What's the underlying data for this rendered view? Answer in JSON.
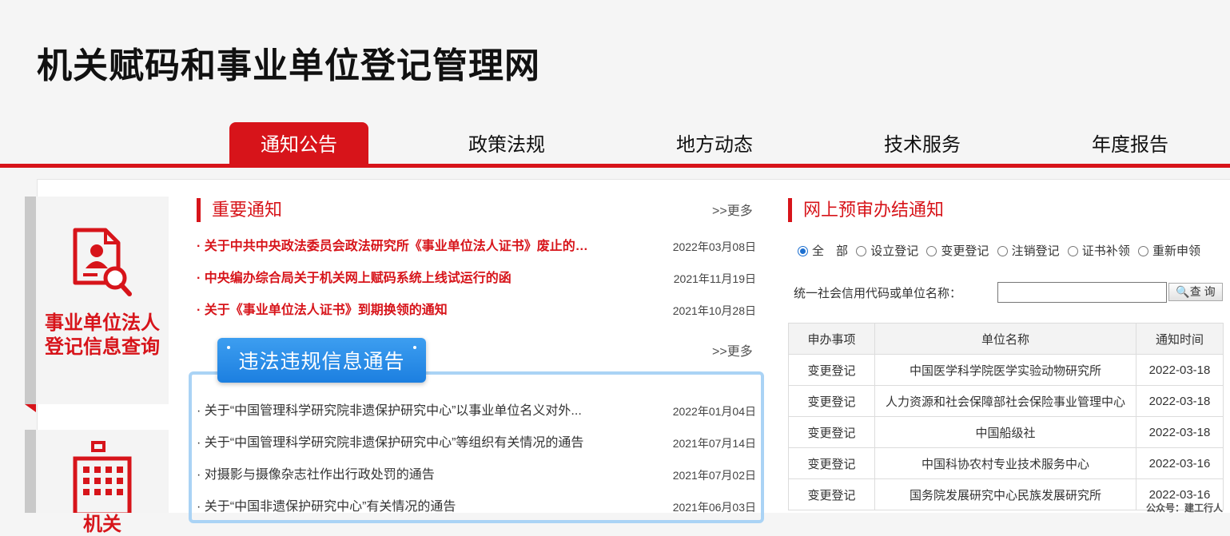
{
  "site": {
    "title": "机关赋码和事业单位登记管理网"
  },
  "nav": [
    {
      "label": "通知公告",
      "active": true
    },
    {
      "label": "政策法规"
    },
    {
      "label": "地方动态"
    },
    {
      "label": "技术服务"
    },
    {
      "label": "年度报告"
    }
  ],
  "left_cards": {
    "card1_line1": "事业单位法人",
    "card1_line2": "登记信息查询",
    "card2_label": "机关"
  },
  "important": {
    "title": "重要通知",
    "more": ">>更多",
    "items": [
      {
        "text": "· 关于中共中央政法委员会政法研究所《事业单位法人证书》废止的…",
        "date": "2022年03月08日"
      },
      {
        "text": "· 中央编办综合局关于机关网上赋码系统上线试运行的函",
        "date": "2021年11月19日"
      },
      {
        "text": "· 关于《事业单位法人证书》到期换领的通知",
        "date": "2021年10月28日"
      }
    ]
  },
  "violations": {
    "title": "违法违规信息通告",
    "more": ">>更多",
    "items": [
      {
        "text": "· 关于“中国管理科学研究院非遗保护研究中心”以事业单位名义对外...",
        "date": "2022年01月04日"
      },
      {
        "text": "· 关于“中国管理科学研究院非遗保护研究中心”等组织有关情况的通告",
        "date": "2021年07月14日"
      },
      {
        "text": "· 对摄影与摄像杂志社作出行政处罚的通告",
        "date": "2021年07月02日"
      },
      {
        "text": "· 关于“中国非遗保护研究中心”有关情况的通告",
        "date": "2021年06月03日"
      }
    ]
  },
  "prereview": {
    "title": "网上预审办结通知",
    "radios": [
      "全　部",
      "设立登记",
      "变更登记",
      "注销登记",
      "证书补领",
      "重新申领"
    ],
    "search_label": "统一社会信用代码或单位名称：",
    "search_value": "",
    "search_button": "查 询",
    "columns": [
      "申办事项",
      "单位名称",
      "通知时间"
    ],
    "rows": [
      [
        "变更登记",
        "中国医学科学院医学实验动物研究所",
        "2022-03-18"
      ],
      [
        "变更登记",
        "人力资源和社会保障部社会保险事业管理中心",
        "2022-03-18"
      ],
      [
        "变更登记",
        "中国船级社",
        "2022-03-18"
      ],
      [
        "变更登记",
        "中国科协农村专业技术服务中心",
        "2022-03-16"
      ],
      [
        "变更登记",
        "国务院发展研究中心民族发展研究所",
        "2022-03-16"
      ]
    ]
  },
  "watermark": "公众号：建工行人",
  "colors": {
    "brand_red": "#d7141a",
    "badge_blue": "#1c7fe0",
    "box_border": "#aad3f5"
  }
}
